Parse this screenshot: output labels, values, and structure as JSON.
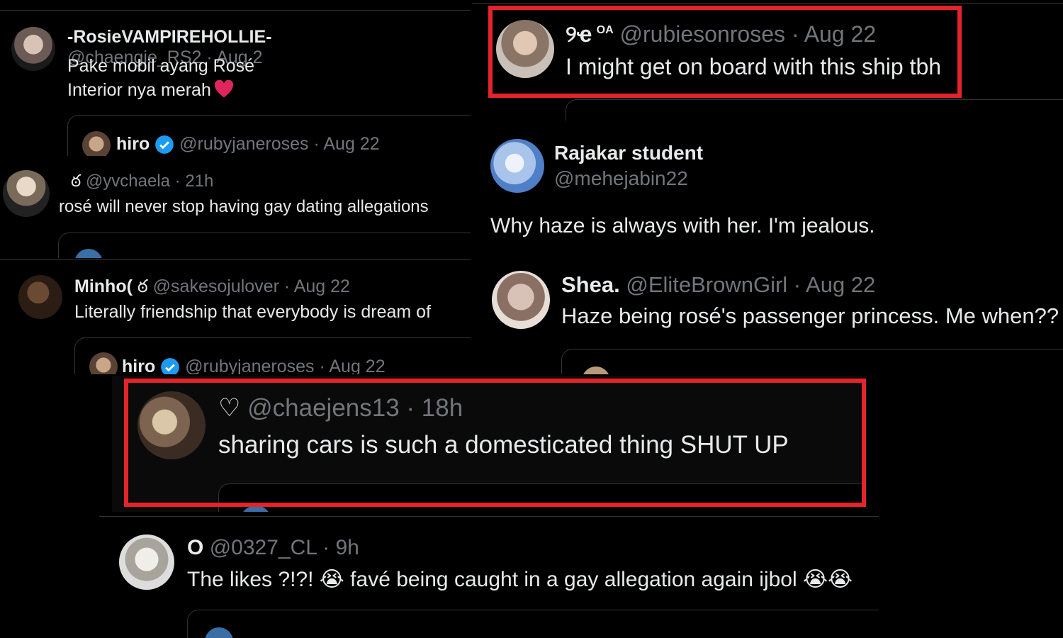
{
  "colors": {
    "background": "#000000",
    "text": "#e7e9ea",
    "muted": "#71767b",
    "divider": "#2f3336",
    "highlight": "#e5232a",
    "verified": "#1d9bf0",
    "heart": "#e0245e"
  },
  "tweets": [
    {
      "id": "rosie",
      "name": "-RosieVAMPIREHOLLIE-",
      "handle": "@chaengie_RS2 · Aug 2",
      "line1": "Pake mobil ayang Rosé",
      "line2": "Interior nya merah",
      "quote_name": "hiro",
      "quote_handle": "@rubyjaneroses · Aug 22"
    },
    {
      "id": "yvchaela",
      "badge": "ఠ",
      "handle": "@yvchaela · 21h",
      "text": "rosé will never stop having gay dating allegations"
    },
    {
      "id": "minho",
      "name": "Minho(",
      "badge": "ఠ",
      "handle": "@sakesojulover · Aug 22",
      "text": "Literally friendship that everybody is dream of",
      "quote_name": "hiro",
      "quote_handle": "@rubyjaneroses · Aug 22"
    },
    {
      "id": "rubies",
      "name": "୨ҽ",
      "sup": "OA",
      "handle": "@rubiesonroses · Aug 22",
      "text": "I might get on board with this ship tbh",
      "highlighted": true
    },
    {
      "id": "rajakar",
      "name": "Rajakar student",
      "handle": "@mehejabin22",
      "text": "Why haze is always with her. I'm jealous."
    },
    {
      "id": "shea",
      "name": "Shea.",
      "handle": "@EliteBrownGirl · Aug 22",
      "text": "Haze being rosé's passenger princess. Me when??"
    },
    {
      "id": "chaejens",
      "badge": "♡",
      "handle": "@chaejens13 · 18h",
      "text": "sharing cars is such a domesticated thing SHUT UP",
      "highlighted": true
    },
    {
      "id": "o",
      "name": "O",
      "handle": "@0327_CL · 9h",
      "text_a": "The likes ?!?!",
      "emoji": "😭",
      "text_b": "favé being caught in a gay allegation again ijbol"
    }
  ]
}
